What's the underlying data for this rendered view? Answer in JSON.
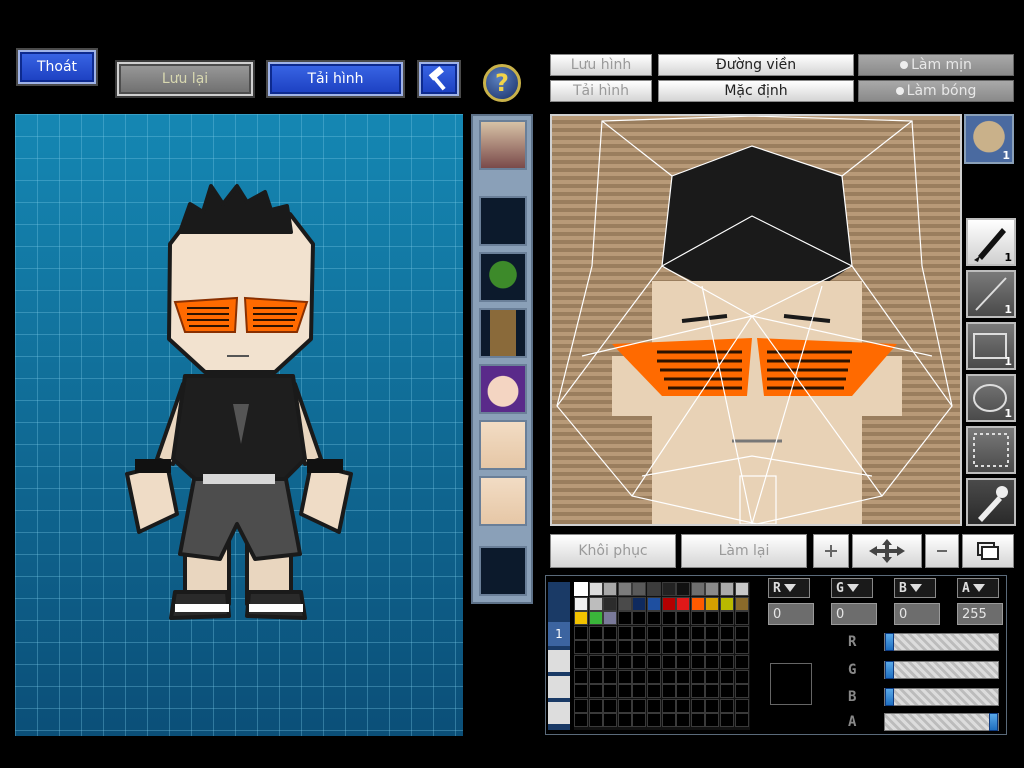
{
  "toolbar": {
    "exit_label": "Thoát",
    "save_label": "Lưu lại",
    "load_image_label": "Tải hình"
  },
  "editor": {
    "save_image_label": "Lưu hình",
    "load_image_label": "Tải hình",
    "outline_label": "Đường viền",
    "default_label": "Mặc định",
    "smooth_label": "Làm mịn",
    "gloss_label": "Làm bóng",
    "restore_label": "Khôi phục",
    "redo_label": "Làm lại",
    "layer_badge": "1"
  },
  "tools": [
    {
      "name": "brush",
      "count": "1",
      "active": true
    },
    {
      "name": "line",
      "count": "1",
      "active": false
    },
    {
      "name": "rectangle",
      "count": "1",
      "active": false
    },
    {
      "name": "ellipse",
      "count": "1",
      "active": false
    },
    {
      "name": "selection",
      "count": "",
      "active": false
    },
    {
      "name": "eyedropper",
      "count": "",
      "active": false
    }
  ],
  "color": {
    "r_label": "R",
    "g_label": "G",
    "b_label": "B",
    "a_label": "A",
    "r_value": "0",
    "g_value": "0",
    "b_value": "0",
    "a_value": "255",
    "r_fraction": 0,
    "g_fraction": 0,
    "b_fraction": 0,
    "a_fraction": 1,
    "current": "#000000",
    "palette": [
      "#ffffff",
      "#dcdcdc",
      "#a8a8a8",
      "#7c7c7c",
      "#5a5a5a",
      "#3c3c3c",
      "#222222",
      "#111111",
      "#6e6e6e",
      "#8a8a8a",
      "#aaaaaa",
      "#c8c8c8",
      "#efefef",
      "#bdbdbd",
      "#2c2c2c",
      "#4a4a4a",
      "#0f2a5e",
      "#1e4fa0",
      "#b40000",
      "#e01818",
      "#ff5a00",
      "#d6a000",
      "#b9b900",
      "#8a6a2a",
      "#f2c200",
      "#3ab53a",
      "#7a7a9a"
    ],
    "layer_tab_label": "1"
  },
  "colors": {
    "accent_blue": "#1c3fc0",
    "glasses_orange": "#ff6a00",
    "preview_bg": "#0f6f97"
  }
}
